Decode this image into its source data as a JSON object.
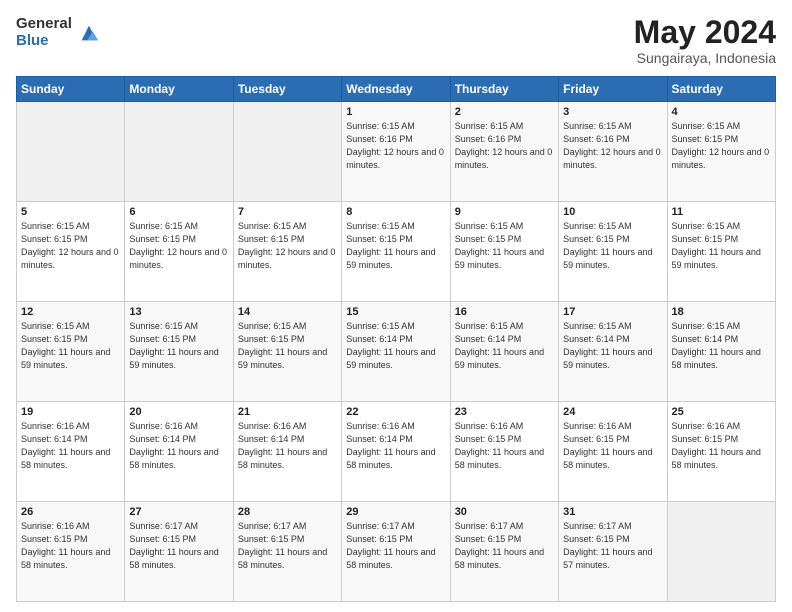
{
  "header": {
    "logo_general": "General",
    "logo_blue": "Blue",
    "month_year": "May 2024",
    "location": "Sungairaya, Indonesia"
  },
  "weekdays": [
    "Sunday",
    "Monday",
    "Tuesday",
    "Wednesday",
    "Thursday",
    "Friday",
    "Saturday"
  ],
  "weeks": [
    [
      {
        "day": "",
        "sunrise": "",
        "sunset": "",
        "daylight": ""
      },
      {
        "day": "",
        "sunrise": "",
        "sunset": "",
        "daylight": ""
      },
      {
        "day": "",
        "sunrise": "",
        "sunset": "",
        "daylight": ""
      },
      {
        "day": "1",
        "sunrise": "Sunrise: 6:15 AM",
        "sunset": "Sunset: 6:16 PM",
        "daylight": "Daylight: 12 hours and 0 minutes."
      },
      {
        "day": "2",
        "sunrise": "Sunrise: 6:15 AM",
        "sunset": "Sunset: 6:16 PM",
        "daylight": "Daylight: 12 hours and 0 minutes."
      },
      {
        "day": "3",
        "sunrise": "Sunrise: 6:15 AM",
        "sunset": "Sunset: 6:16 PM",
        "daylight": "Daylight: 12 hours and 0 minutes."
      },
      {
        "day": "4",
        "sunrise": "Sunrise: 6:15 AM",
        "sunset": "Sunset: 6:15 PM",
        "daylight": "Daylight: 12 hours and 0 minutes."
      }
    ],
    [
      {
        "day": "5",
        "sunrise": "Sunrise: 6:15 AM",
        "sunset": "Sunset: 6:15 PM",
        "daylight": "Daylight: 12 hours and 0 minutes."
      },
      {
        "day": "6",
        "sunrise": "Sunrise: 6:15 AM",
        "sunset": "Sunset: 6:15 PM",
        "daylight": "Daylight: 12 hours and 0 minutes."
      },
      {
        "day": "7",
        "sunrise": "Sunrise: 6:15 AM",
        "sunset": "Sunset: 6:15 PM",
        "daylight": "Daylight: 12 hours and 0 minutes."
      },
      {
        "day": "8",
        "sunrise": "Sunrise: 6:15 AM",
        "sunset": "Sunset: 6:15 PM",
        "daylight": "Daylight: 11 hours and 59 minutes."
      },
      {
        "day": "9",
        "sunrise": "Sunrise: 6:15 AM",
        "sunset": "Sunset: 6:15 PM",
        "daylight": "Daylight: 11 hours and 59 minutes."
      },
      {
        "day": "10",
        "sunrise": "Sunrise: 6:15 AM",
        "sunset": "Sunset: 6:15 PM",
        "daylight": "Daylight: 11 hours and 59 minutes."
      },
      {
        "day": "11",
        "sunrise": "Sunrise: 6:15 AM",
        "sunset": "Sunset: 6:15 PM",
        "daylight": "Daylight: 11 hours and 59 minutes."
      }
    ],
    [
      {
        "day": "12",
        "sunrise": "Sunrise: 6:15 AM",
        "sunset": "Sunset: 6:15 PM",
        "daylight": "Daylight: 11 hours and 59 minutes."
      },
      {
        "day": "13",
        "sunrise": "Sunrise: 6:15 AM",
        "sunset": "Sunset: 6:15 PM",
        "daylight": "Daylight: 11 hours and 59 minutes."
      },
      {
        "day": "14",
        "sunrise": "Sunrise: 6:15 AM",
        "sunset": "Sunset: 6:15 PM",
        "daylight": "Daylight: 11 hours and 59 minutes."
      },
      {
        "day": "15",
        "sunrise": "Sunrise: 6:15 AM",
        "sunset": "Sunset: 6:14 PM",
        "daylight": "Daylight: 11 hours and 59 minutes."
      },
      {
        "day": "16",
        "sunrise": "Sunrise: 6:15 AM",
        "sunset": "Sunset: 6:14 PM",
        "daylight": "Daylight: 11 hours and 59 minutes."
      },
      {
        "day": "17",
        "sunrise": "Sunrise: 6:15 AM",
        "sunset": "Sunset: 6:14 PM",
        "daylight": "Daylight: 11 hours and 59 minutes."
      },
      {
        "day": "18",
        "sunrise": "Sunrise: 6:15 AM",
        "sunset": "Sunset: 6:14 PM",
        "daylight": "Daylight: 11 hours and 58 minutes."
      }
    ],
    [
      {
        "day": "19",
        "sunrise": "Sunrise: 6:16 AM",
        "sunset": "Sunset: 6:14 PM",
        "daylight": "Daylight: 11 hours and 58 minutes."
      },
      {
        "day": "20",
        "sunrise": "Sunrise: 6:16 AM",
        "sunset": "Sunset: 6:14 PM",
        "daylight": "Daylight: 11 hours and 58 minutes."
      },
      {
        "day": "21",
        "sunrise": "Sunrise: 6:16 AM",
        "sunset": "Sunset: 6:14 PM",
        "daylight": "Daylight: 11 hours and 58 minutes."
      },
      {
        "day": "22",
        "sunrise": "Sunrise: 6:16 AM",
        "sunset": "Sunset: 6:14 PM",
        "daylight": "Daylight: 11 hours and 58 minutes."
      },
      {
        "day": "23",
        "sunrise": "Sunrise: 6:16 AM",
        "sunset": "Sunset: 6:15 PM",
        "daylight": "Daylight: 11 hours and 58 minutes."
      },
      {
        "day": "24",
        "sunrise": "Sunrise: 6:16 AM",
        "sunset": "Sunset: 6:15 PM",
        "daylight": "Daylight: 11 hours and 58 minutes."
      },
      {
        "day": "25",
        "sunrise": "Sunrise: 6:16 AM",
        "sunset": "Sunset: 6:15 PM",
        "daylight": "Daylight: 11 hours and 58 minutes."
      }
    ],
    [
      {
        "day": "26",
        "sunrise": "Sunrise: 6:16 AM",
        "sunset": "Sunset: 6:15 PM",
        "daylight": "Daylight: 11 hours and 58 minutes."
      },
      {
        "day": "27",
        "sunrise": "Sunrise: 6:17 AM",
        "sunset": "Sunset: 6:15 PM",
        "daylight": "Daylight: 11 hours and 58 minutes."
      },
      {
        "day": "28",
        "sunrise": "Sunrise: 6:17 AM",
        "sunset": "Sunset: 6:15 PM",
        "daylight": "Daylight: 11 hours and 58 minutes."
      },
      {
        "day": "29",
        "sunrise": "Sunrise: 6:17 AM",
        "sunset": "Sunset: 6:15 PM",
        "daylight": "Daylight: 11 hours and 58 minutes."
      },
      {
        "day": "30",
        "sunrise": "Sunrise: 6:17 AM",
        "sunset": "Sunset: 6:15 PM",
        "daylight": "Daylight: 11 hours and 58 minutes."
      },
      {
        "day": "31",
        "sunrise": "Sunrise: 6:17 AM",
        "sunset": "Sunset: 6:15 PM",
        "daylight": "Daylight: 11 hours and 57 minutes."
      },
      {
        "day": "",
        "sunrise": "",
        "sunset": "",
        "daylight": ""
      }
    ]
  ]
}
